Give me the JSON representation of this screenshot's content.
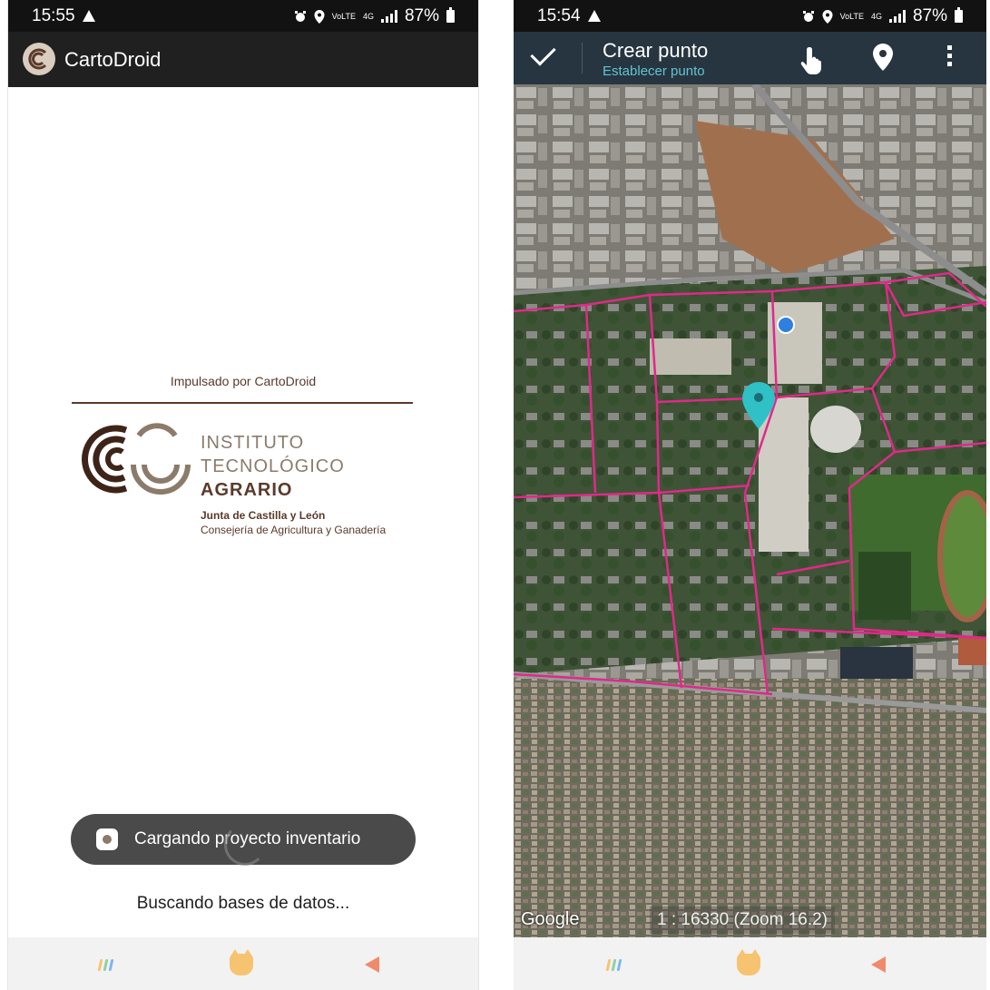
{
  "colors": {
    "toolbar": "#263540",
    "accent": "#62c4cf",
    "boundary": "#e0298a",
    "brand_brown": "#5a3a2a",
    "brand_tan": "#8c7b6b",
    "location_dot": "#2f7fe0"
  },
  "left_screen": {
    "status": {
      "time": "15:55",
      "battery": "87%",
      "volte": "VoLTE",
      "network": "4G"
    },
    "app_bar": {
      "title": "CartoDroid",
      "logo_icon": "cartodroid-logo-icon"
    },
    "powered_by": "Impulsado por CartoDroid",
    "institute": {
      "line1": "INSTITUTO",
      "line2": "TECNOLÓGICO",
      "line3": "AGRARIO",
      "sub1": "Junta de Castilla y León",
      "sub2": "Consejería de Agricultura y Ganadería"
    },
    "toast": "Cargando proyecto inventario",
    "loading_text": "Buscando bases de datos...",
    "nav": {
      "recents_icon": "recents-icon",
      "home_icon": "home-icon",
      "back_icon": "back-icon"
    }
  },
  "right_screen": {
    "status": {
      "time": "15:54",
      "battery": "87%",
      "volte": "VoLTE",
      "network": "4G"
    },
    "toolbar": {
      "title": "Crear punto",
      "subtitle": "Establecer punto",
      "confirm_icon": "check-icon",
      "hand_icon": "hand-pointer-icon",
      "pin_icon": "map-pin-icon",
      "menu_icon": "more-vert-icon"
    },
    "map": {
      "attribution": "Google",
      "scale_text": "1 : 16330 (Zoom 16.2)"
    },
    "nav": {
      "recents_icon": "recents-icon",
      "home_icon": "home-icon",
      "back_icon": "back-icon"
    }
  }
}
